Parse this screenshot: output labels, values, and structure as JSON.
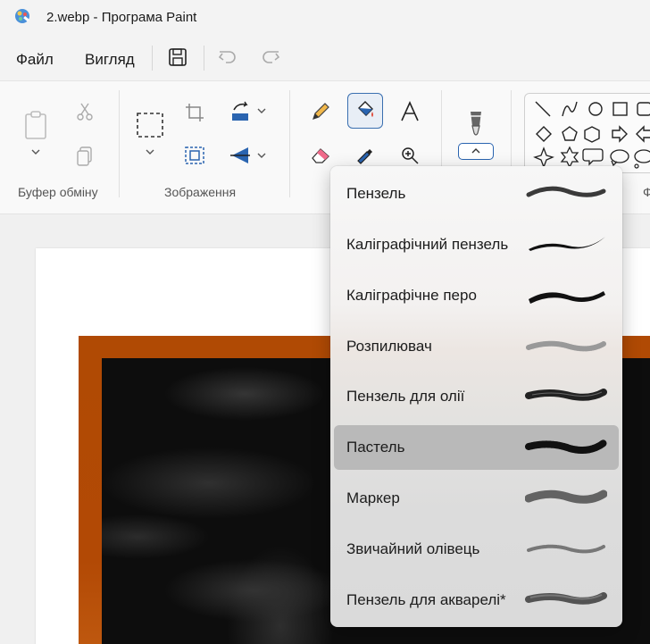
{
  "window": {
    "title": "2.webp - Програма Paint"
  },
  "menu": {
    "file": "Файл",
    "view": "Вигляд"
  },
  "ribbon": {
    "groups": {
      "clipboard": "Буфер обміну",
      "image": "Зображення"
    }
  },
  "brush_menu": {
    "items": [
      {
        "label": "Пензель",
        "selected": false
      },
      {
        "label": "Каліграфічний пензель",
        "selected": false
      },
      {
        "label": "Каліграфічне перо",
        "selected": false
      },
      {
        "label": "Розпилювач",
        "selected": false
      },
      {
        "label": "Пензель для олії",
        "selected": false
      },
      {
        "label": "Пастель",
        "selected": true
      },
      {
        "label": "Маркер",
        "selected": false
      },
      {
        "label": "Звичайний олівець",
        "selected": false
      },
      {
        "label": "Пензель для акварелі*",
        "selected": false
      }
    ]
  },
  "colors": {
    "accent": "#2a64b0",
    "frame": "#b04a04",
    "selected_row": "#b9b9b9"
  }
}
